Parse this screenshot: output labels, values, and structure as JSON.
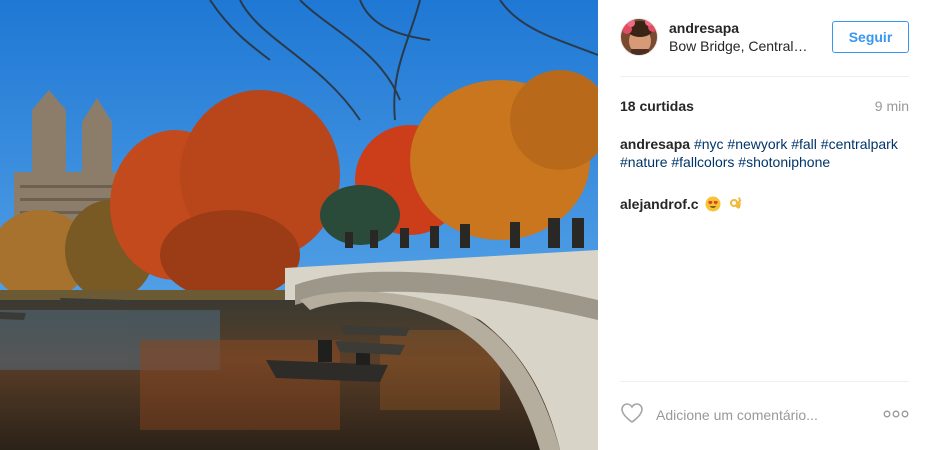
{
  "post": {
    "photo_alt": "",
    "author": {
      "username": "andresapa",
      "location": "Bow Bridge, Central…"
    },
    "follow_label": "Seguir",
    "likes": "18 curtidas",
    "time": "9 min",
    "caption": {
      "username": "andresapa",
      "hashtags": [
        "#nyc",
        "#newyork",
        "#fall",
        "#centralpark",
        "#nature",
        "#fallcolors",
        "#shotoniphone"
      ]
    },
    "comments": [
      {
        "username": "alejandrof.c",
        "emojis": [
          "heart-eyes-emoji",
          "ok-hand-emoji"
        ]
      }
    ],
    "add_comment_placeholder": "Adicione um comentário...",
    "colors": {
      "accent": "#3897f0",
      "hashtag": "#003569",
      "muted": "#999999"
    }
  }
}
